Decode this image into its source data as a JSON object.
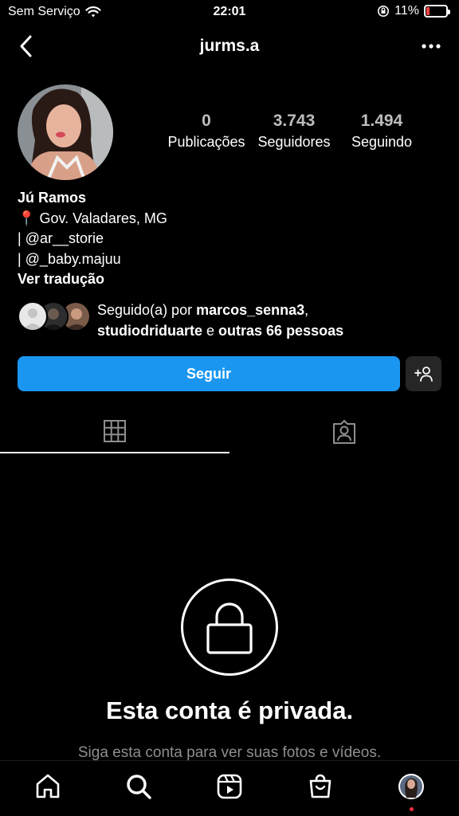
{
  "status_bar": {
    "carrier": "Sem Serviço",
    "time": "22:01",
    "battery": "11%"
  },
  "header": {
    "username": "jurms.a"
  },
  "stats": {
    "posts": {
      "value": "0",
      "label": "Publicações"
    },
    "followers": {
      "value": "3.743",
      "label": "Seguidores"
    },
    "following": {
      "value": "1.494",
      "label": "Seguindo"
    }
  },
  "bio": {
    "name": "Jú Ramos",
    "location_emoji": "📍",
    "location": "Gov. Valadares, MG",
    "line1": "| @ar__storie",
    "line2": "| @_baby.majuu",
    "translate": "Ver tradução"
  },
  "followed_by": {
    "prefix": "Seguido(a) por ",
    "user1": "marcos_senna3",
    "comma": ",",
    "user2": "studiodriduarte",
    "conj": " e ",
    "others": "outras 66 pessoas"
  },
  "actions": {
    "follow_label": "Seguir"
  },
  "private": {
    "title": "Esta conta é privada.",
    "subtitle": "Siga esta conta para ver suas fotos e vídeos."
  },
  "icons": {
    "back": "chevron-left-icon",
    "more": "more-horizontal-icon",
    "grid": "grid-icon",
    "tagged": "tagged-person-icon",
    "lock": "lock-icon",
    "home": "home-icon",
    "search": "search-icon",
    "reels": "reels-icon",
    "shop": "shop-icon"
  },
  "colors": {
    "background": "#000000",
    "follow_button": "#1a96f0",
    "secondary_button": "#262626",
    "muted_text": "#8e8e8e",
    "notification_dot": "#ff3040"
  }
}
